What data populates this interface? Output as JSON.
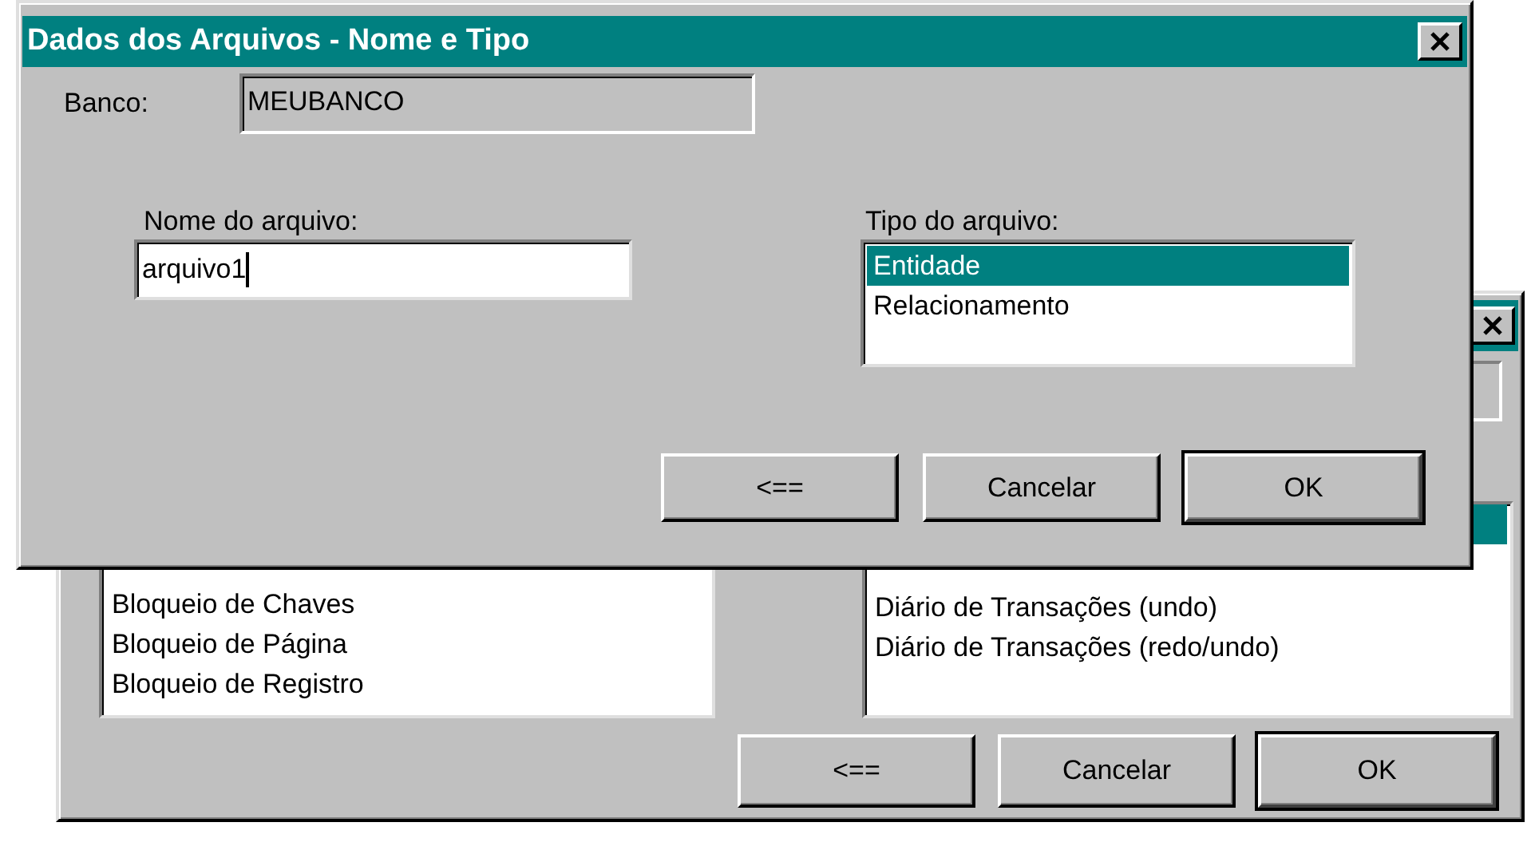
{
  "back_window": {
    "left_list": {
      "items": [
        {
          "text": "Bloqueio de Chaves",
          "selected": false
        },
        {
          "text": "Bloqueio de Página",
          "selected": false
        },
        {
          "text": "Bloqueio de Registro",
          "selected": false
        }
      ]
    },
    "right_list": {
      "items": [
        {
          "selected": true
        },
        {
          "text": "Diário de Transações (undo)",
          "selected": false
        },
        {
          "text": "Diário de Transações (redo/undo)",
          "selected": false
        }
      ]
    },
    "buttons": [
      {
        "label": "<==",
        "default": false
      },
      {
        "label": "Cancelar",
        "default": false
      },
      {
        "label": "OK",
        "default": true
      }
    ]
  },
  "dialog": {
    "title": "Dados dos Arquivos - Nome e Tipo",
    "banco_label": "Banco:",
    "banco_value": "MEUBANCO",
    "name_label": "Nome do arquivo:",
    "name_value": "arquivo1",
    "type_label": "Tipo do arquivo:",
    "type_list": {
      "items": [
        {
          "text": "Entidade",
          "selected": true
        },
        {
          "text": "Relacionamento",
          "selected": false
        }
      ]
    },
    "buttons": [
      {
        "label": "<==",
        "default": false
      },
      {
        "label": "Cancelar",
        "default": false
      },
      {
        "label": "OK",
        "default": true
      }
    ]
  }
}
